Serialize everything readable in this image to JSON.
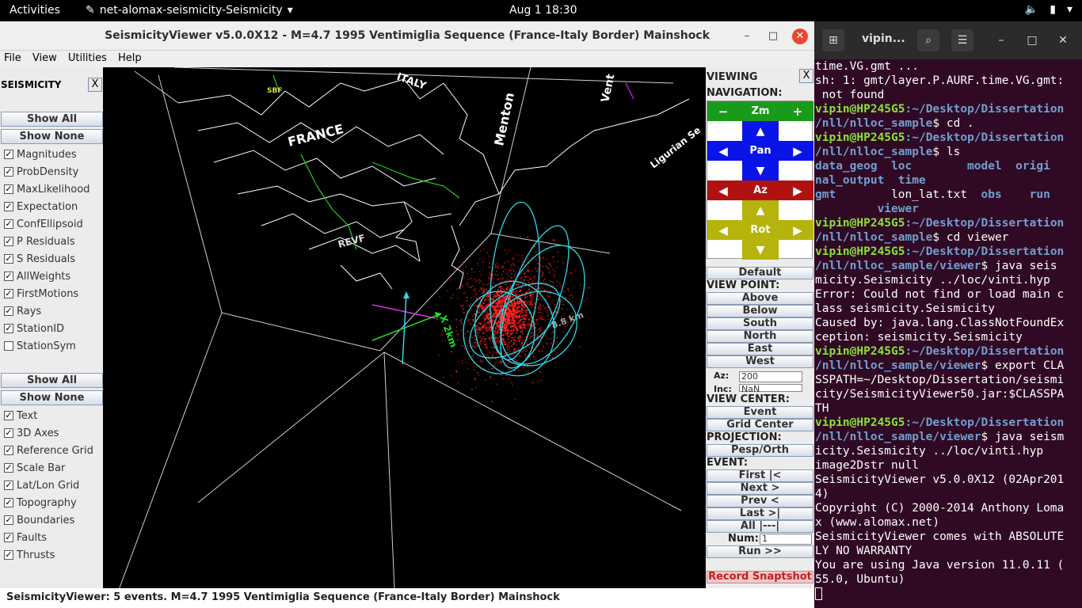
{
  "topbar": {
    "activities": "Activities",
    "app_name": "net-alomax-seismicity-Seismicity",
    "clock": "Aug 1  18:30"
  },
  "window": {
    "title": "SeismicityViewer v5.0.0X12 - M=4.7 1995 Ventimiglia Sequence (France-Italy Border) Mainshock",
    "minimize": "–",
    "maximize": "□",
    "close": "✕"
  },
  "menu": [
    "File",
    "View",
    "Utilities",
    "Help"
  ],
  "seismicity_panel": {
    "header": "SEISMICITY",
    "close": "X",
    "show_all": "Show All",
    "show_none": "Show None",
    "checks": [
      {
        "label": "Magnitudes",
        "checked": true
      },
      {
        "label": "ProbDensity",
        "checked": true
      },
      {
        "label": "MaxLikelihood",
        "checked": true
      },
      {
        "label": "Expectation",
        "checked": true
      },
      {
        "label": "ConfEllipsoid",
        "checked": true
      },
      {
        "label": "P Residuals",
        "checked": true
      },
      {
        "label": "S Residuals",
        "checked": true
      },
      {
        "label": "AllWeights",
        "checked": true
      },
      {
        "label": "FirstMotions",
        "checked": true
      },
      {
        "label": "Rays",
        "checked": true
      },
      {
        "label": "StationID",
        "checked": true
      },
      {
        "label": "StationSym",
        "checked": false
      }
    ],
    "show_all_2": "Show All",
    "show_none_2": "Show None",
    "checks2": [
      {
        "label": "Text",
        "checked": true
      },
      {
        "label": "3D Axes",
        "checked": true
      },
      {
        "label": "Reference Grid",
        "checked": true
      },
      {
        "label": "Scale Bar",
        "checked": true
      },
      {
        "label": "Lat/Lon Grid",
        "checked": true
      },
      {
        "label": "Topography",
        "checked": true
      },
      {
        "label": "Boundaries",
        "checked": true
      },
      {
        "label": "Faults",
        "checked": true
      },
      {
        "label": "Thrusts",
        "checked": true
      }
    ]
  },
  "map_labels": {
    "france": "FRANCE",
    "italy": "ITALY",
    "menton": "Menton",
    "vent": "Vent",
    "ligurian": "Ligurian Se",
    "revf": "REVF",
    "sbf": "SBF",
    "x_axis": "X 2km",
    "scale": "8.8 km"
  },
  "nav_panel": {
    "viewing": "VIEWING",
    "close": "X",
    "navigation": "NAVIGATION:",
    "zoom": "Zm",
    "zoom_minus": "−",
    "zoom_plus": "+",
    "pan": "Pan",
    "az": "Az",
    "rot": "Rot",
    "default": "Default",
    "view_point": "VIEW POINT:",
    "above": "Above",
    "below": "Below",
    "south": "South",
    "north": "North",
    "east": "East",
    "west": "West",
    "az_label": "Az:",
    "az_value": "200",
    "inc_label": "Inc:",
    "inc_value": "NaN",
    "view_center": "VIEW CENTER:",
    "event_btn": "Event",
    "grid_center": "Grid Center",
    "projection": "PROJECTION:",
    "pesp": "Pesp/Orth",
    "event_label": "EVENT:",
    "first": "First    |<",
    "next": "Next     >",
    "prev": "Prev     <",
    "last": "Last    >|",
    "all": "All     |---|",
    "num_label": "Num:",
    "num_value": "1",
    "run": "Run     >>",
    "record": "Record Snaptshot"
  },
  "statusbar": "SeismicityViewer: 5 events. M=4.7 1995 Ventimiglia Sequence (France-Italy Border) Mainshock",
  "colors": {
    "nav_green": "#1a9a1a",
    "nav_blue": "#0a14e8",
    "nav_red": "#b01212",
    "nav_olive": "#b4b40c",
    "ellipse": "#30d8e8",
    "scatter": "#e01010",
    "terminal_bg": "#300a24"
  },
  "terminal": {
    "title": "vipin...",
    "lines": [
      {
        "t": "text",
        "v": "time.VG.gmt ..."
      },
      {
        "t": "text",
        "v": "sh: 1: gmt/layer.P.AURF.time.VG.gmt:"
      },
      {
        "t": "text",
        "v": " not found"
      },
      {
        "t": "prompt",
        "user": "vipin@HP245G5",
        "path": ":~/Desktop/Dissertation",
        "path2": "/nll/nlloc_sample",
        "cmd": "$ cd ."
      },
      {
        "t": "prompt",
        "user": "vipin@HP245G5",
        "path": ":~/Desktop/Dissertation",
        "path2": "/nll/nlloc_sample",
        "cmd": "$ ls"
      },
      {
        "t": "dir",
        "v": "data_geog  loc        model  origi"
      },
      {
        "t": "dir",
        "v": "nal_output  time"
      },
      {
        "t": "mixed",
        "a": "gmt",
        "b": "        lon_lat.txt  ",
        "c": "obs    run"
      },
      {
        "t": "dir",
        "v": "         viewer"
      },
      {
        "t": "prompt",
        "user": "vipin@HP245G5",
        "path": ":~/Desktop/Dissertation",
        "path2": "/nll/nlloc_sample",
        "cmd": "$ cd viewer"
      },
      {
        "t": "prompt",
        "user": "vipin@HP245G5",
        "path": ":~/Desktop/Dissertation",
        "path2": "/nll/nlloc_sample/viewer",
        "cmd": "$ java seis"
      },
      {
        "t": "text",
        "v": "micity.Seismicity ../loc/vinti.hyp"
      },
      {
        "t": "text",
        "v": "Error: Could not find or load main c"
      },
      {
        "t": "text",
        "v": "lass seismicity.Seismicity"
      },
      {
        "t": "text",
        "v": "Caused by: java.lang.ClassNotFoundEx"
      },
      {
        "t": "text",
        "v": "ception: seismicity.Seismicity"
      },
      {
        "t": "prompt",
        "user": "vipin@HP245G5",
        "path": ":~/Desktop/Dissertation",
        "path2": "/nll/nlloc_sample/viewer",
        "cmd": "$ export CLA"
      },
      {
        "t": "text",
        "v": "SSPATH=~/Desktop/Dissertation/seismi"
      },
      {
        "t": "text",
        "v": "city/SeismicityViewer50.jar:$CLASSPA"
      },
      {
        "t": "text",
        "v": "TH"
      },
      {
        "t": "prompt",
        "user": "vipin@HP245G5",
        "path": ":~/Desktop/Dissertation",
        "path2": "/nll/nlloc_sample/viewer",
        "cmd": "$ java seism"
      },
      {
        "t": "text",
        "v": "icity.Seismicity ../loc/vinti.hyp"
      },
      {
        "t": "text",
        "v": "image2Dstr null"
      },
      {
        "t": "text",
        "v": "SeismicityViewer v5.0.0X12 (02Apr201"
      },
      {
        "t": "text",
        "v": "4)"
      },
      {
        "t": "text",
        "v": "Copyright (C) 2000-2014 Anthony Loma"
      },
      {
        "t": "text",
        "v": "x (www.alomax.net)"
      },
      {
        "t": "text",
        "v": "SeismicityViewer comes with ABSOLUTE"
      },
      {
        "t": "text",
        "v": "LY NO WARRANTY"
      },
      {
        "t": "text",
        "v": "You are using Java version 11.0.11 ("
      },
      {
        "t": "text",
        "v": "55.0, Ubuntu)"
      }
    ]
  }
}
